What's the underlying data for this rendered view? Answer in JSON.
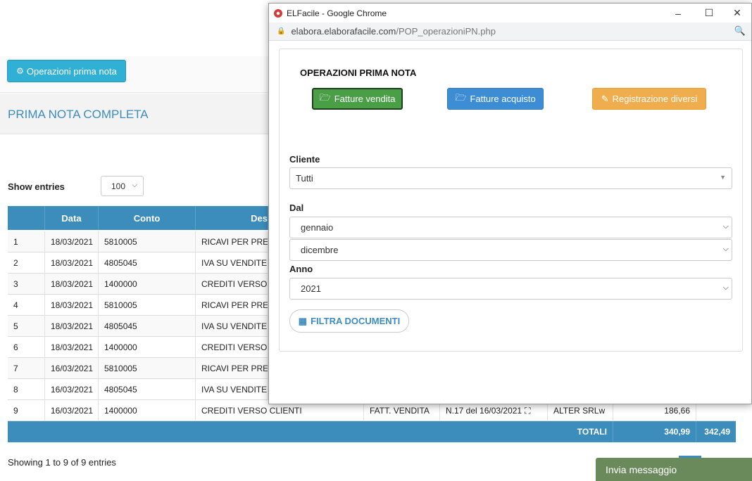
{
  "page": {
    "ops_button_label": "Operazioni prima nota",
    "title": "PRIMA NOTA COMPLETA",
    "show_entries_label": "Show entries",
    "entries_value": "100",
    "showing_text": "Showing 1 to 9 of 9 entries",
    "chat_label": "Invia messaggio"
  },
  "table": {
    "headers": [
      "",
      "Data",
      "Conto",
      "Des"
    ],
    "rows": [
      {
        "n": "1",
        "data": "18/03/2021",
        "conto": "5810005",
        "desc": "RICAVI PER PRES"
      },
      {
        "n": "2",
        "data": "18/03/2021",
        "conto": "4805045",
        "desc": "IVA SU VENDITE"
      },
      {
        "n": "3",
        "data": "18/03/2021",
        "conto": "1400000",
        "desc": "CREDITI VERSO C"
      },
      {
        "n": "4",
        "data": "18/03/2021",
        "conto": "5810005",
        "desc": "RICAVI PER PRES"
      },
      {
        "n": "5",
        "data": "18/03/2021",
        "conto": "4805045",
        "desc": "IVA SU VENDITE"
      },
      {
        "n": "6",
        "data": "18/03/2021",
        "conto": "1400000",
        "desc": "CREDITI VERSO C"
      },
      {
        "n": "7",
        "data": "16/03/2021",
        "conto": "5810005",
        "desc": "RICAVI PER PRES"
      },
      {
        "n": "8",
        "data": "16/03/2021",
        "conto": "4805045",
        "desc": "IVA SU VENDITE"
      }
    ],
    "last_row": {
      "n": "9",
      "data": "16/03/2021",
      "conto": "1400000",
      "desc": "CREDITI VERSO CLIENTI",
      "causale": "FATT. VENDITA",
      "doc": "N.17 del 16/03/2021",
      "cliente": "ALTER SRLw",
      "importo": "186,66"
    },
    "totals": {
      "label": "TOTALI",
      "dare": "340,99",
      "avere": "342,49"
    }
  },
  "popup": {
    "window_title": "ELFacile - Google Chrome",
    "url_host": "elabora.elaborafacile.com",
    "url_path": "/POP_operazioniPN.php",
    "heading": "OPERAZIONI PRIMA NOTA",
    "btn_sales": "Fatture vendita",
    "btn_purchases": "Fatture acquisto",
    "btn_misc": "Registrazione diversi",
    "cliente_label": "Cliente",
    "cliente_value": "Tutti",
    "dal_label": "Dal",
    "dal_from": "gennaio",
    "dal_to": "dicembre",
    "anno_label": "Anno",
    "anno_value": "2021",
    "filter_label": "FILTRA DOCUMENTI"
  },
  "colors": {
    "primary": "#3c8dbc",
    "info": "#31b0d5",
    "success": "#4a9e46",
    "warning": "#f0ad4e",
    "chat": "#6b8a5c"
  },
  "icons": {
    "ops_button": "gear-icon",
    "sales": "folder-open-icon",
    "purchases": "folder-open-icon",
    "misc": "edit-icon",
    "filter": "calendar-icon",
    "doc": "binoculars-icon"
  }
}
